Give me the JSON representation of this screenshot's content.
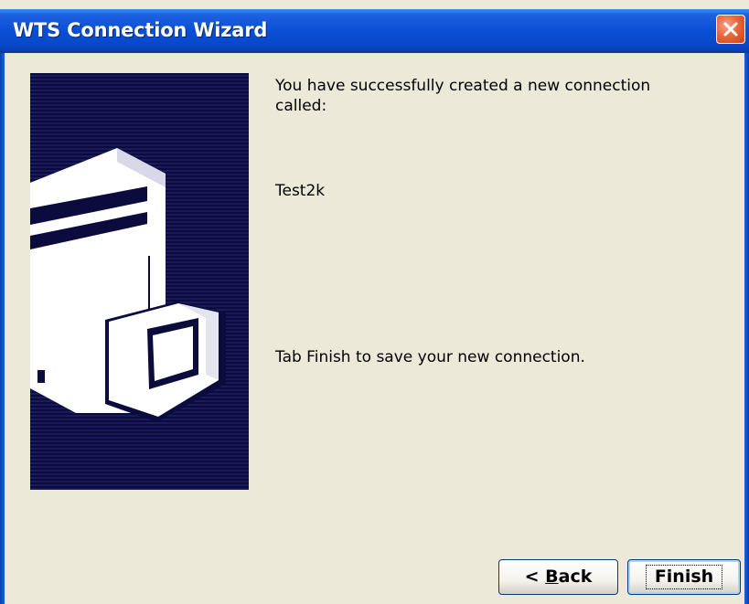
{
  "window": {
    "title": "WTS Connection Wizard"
  },
  "content": {
    "success_message": "You have successfully created a new connection called:",
    "connection_name": "Test2k",
    "instruction": "Tab Finish to save your new connection."
  },
  "buttons": {
    "back_prefix": "< ",
    "back_mnemonic": "B",
    "back_rest": "ack",
    "finish_label": "Finish"
  },
  "icons": {
    "close": "close-icon",
    "banner": "server-computer-illustration"
  },
  "colors": {
    "titlebar": "#0a4fd6",
    "window_bg": "#ece9d8",
    "close_button": "#e8663a",
    "banner_bg": "#0b0b3e"
  }
}
